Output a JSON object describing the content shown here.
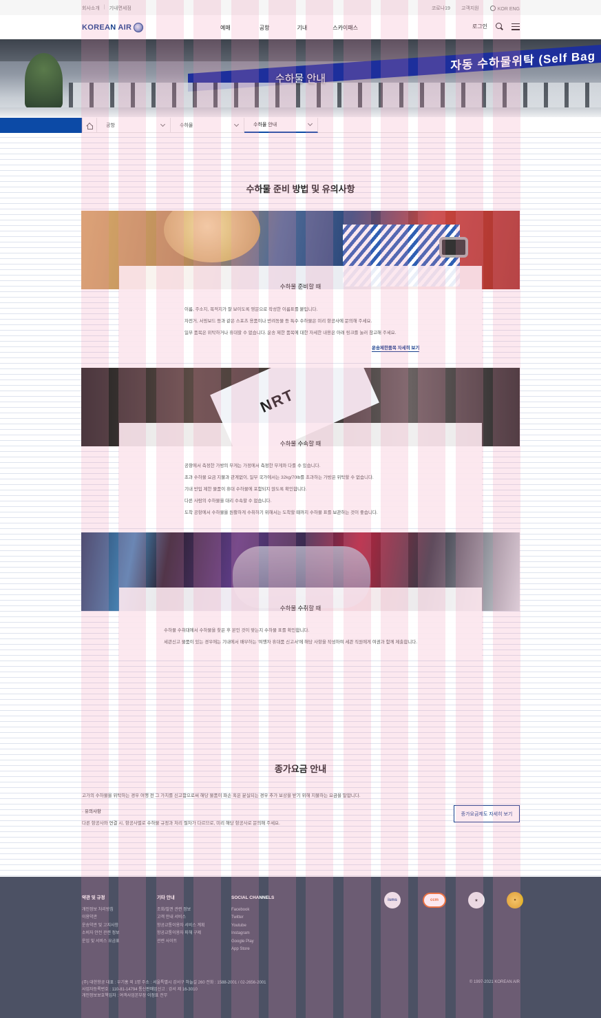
{
  "utility": {
    "left_links": [
      "회사소개",
      "기내면세점"
    ],
    "right_links": [
      "코로나19",
      "고객지원"
    ],
    "language": "KOR ENG"
  },
  "header": {
    "logo_text": "KOREAN AIR",
    "nav": [
      "예매",
      "공항",
      "기내",
      "스카이패스"
    ],
    "login": "로그인"
  },
  "hero": {
    "title": "수하물 안내",
    "sign_text": "자동 수하물위탁 (Self Bag"
  },
  "breadcrumb": {
    "items": [
      "공항",
      "수하물",
      "수하물 안내"
    ]
  },
  "main": {
    "section_title": "수하물 준비 방법 및 유의사항",
    "cards": [
      {
        "title": "수하물 준비할 때",
        "lines": [
          "이름, 주소지, 목적지가 잘 보이도록 영문으로 작성한 이름표를 붙입니다.",
          "자전거, 서핑보드 등과 같은 스포츠 용품이나 반려동물 등 특수 수하물은 미리 항공사에 문의해 주세요.",
          "일부 품목은 위탁하거나 휴대할 수 없습니다. 운송 제한 품목에 대한 자세한 내용은 아래 링크를 눌러 참고해 주세요."
        ],
        "link": "운송제한품목 자세히 보기"
      },
      {
        "title": "수하물 수속할 때",
        "tag_text": "NRT",
        "lines": [
          "공항에서 측정한 가방의 무게는 가정에서 측정한 무게와 다를 수 있습니다.",
          "초과 수하물 요금 지불과 관계없이, 일부 국가에서는 32kg/70lb를 초과하는 가방은 위탁할 수 없습니다.",
          "기내 반입 제한 물품이 휴대 수하물에 포함되지 않도록 확인합니다.",
          "다른 사람의 수하물을 대리 수속할 수 없습니다.",
          "도착 공항에서 수하물을 원활하게 수취하기 위해서는 도착할 때까지 수하물 표를 보관하는 것이 좋습니다."
        ]
      },
      {
        "title": "수하물 수취할 때",
        "lines": [
          "수하물 수취대에서 수하물을 찾은 후 본인 것이 맞는지 수하물 표를 확인합니다.",
          "세관신고 물품이 있는 경우에는 기내에서 배부하는 '여행자 휴대품 신고서'에 해당 사항을 작성하여 세관 직원에게 여권과 함께 제출합니다."
        ]
      }
    ]
  },
  "fee": {
    "title": "종가요금 안내",
    "desc": "고가의 수하물을 위탁하는 경우 여행 전 그 가치를 신고함으로써 해당 물품이 파손 혹은 분실되는 경우 추가 보상을 받기 위해 지불하는 요금을 말합니다.",
    "note_head": "· 유의사항",
    "note": "다른 항공사와 연결 시, 항공사별로 수하물 규정과 처리 절차가 다르므로, 미리 해당 항공사로 문의해 주세요.",
    "button": "종가요금제도 자세히 보기"
  },
  "footer": {
    "col1": {
      "head": "약관 및 규정",
      "items": [
        "개인정보 처리방침",
        "이용약관",
        "운송약관 및 고지사항",
        "소비자 안전 관련 정보",
        "운임 및 서비스 요금표"
      ]
    },
    "col2": {
      "head": "기타 안내",
      "items": [
        "조회/발권 관련 정보",
        "고객 안내 서비스",
        "항공교통이용자 서비스 계획",
        "항공교통이용자 피해 구제",
        "관련 사이트"
      ]
    },
    "col3": {
      "head": "SOCIAL CHANNELS",
      "items": [
        "Facebook",
        "Twitter",
        "Youtube",
        "Instagram",
        "Google Play",
        "App Store"
      ]
    },
    "badges": [
      "isms",
      "ccm"
    ],
    "address_lines": [
      "(주) 대한항공  대표 : 우기홍 외 1명  주소 : 서울특별시 강서구 하늘길 260  전화 : 1588-2001 / 02-2656-2001",
      "사업자등록번호 : 110-81-14794  통신판매업신고 : 강서 제 16-3010",
      "개인정보보호책임자 : 여객사업본부장 이정표 전무"
    ],
    "copyright": "© 1997-2021 KOREAN AIR"
  }
}
